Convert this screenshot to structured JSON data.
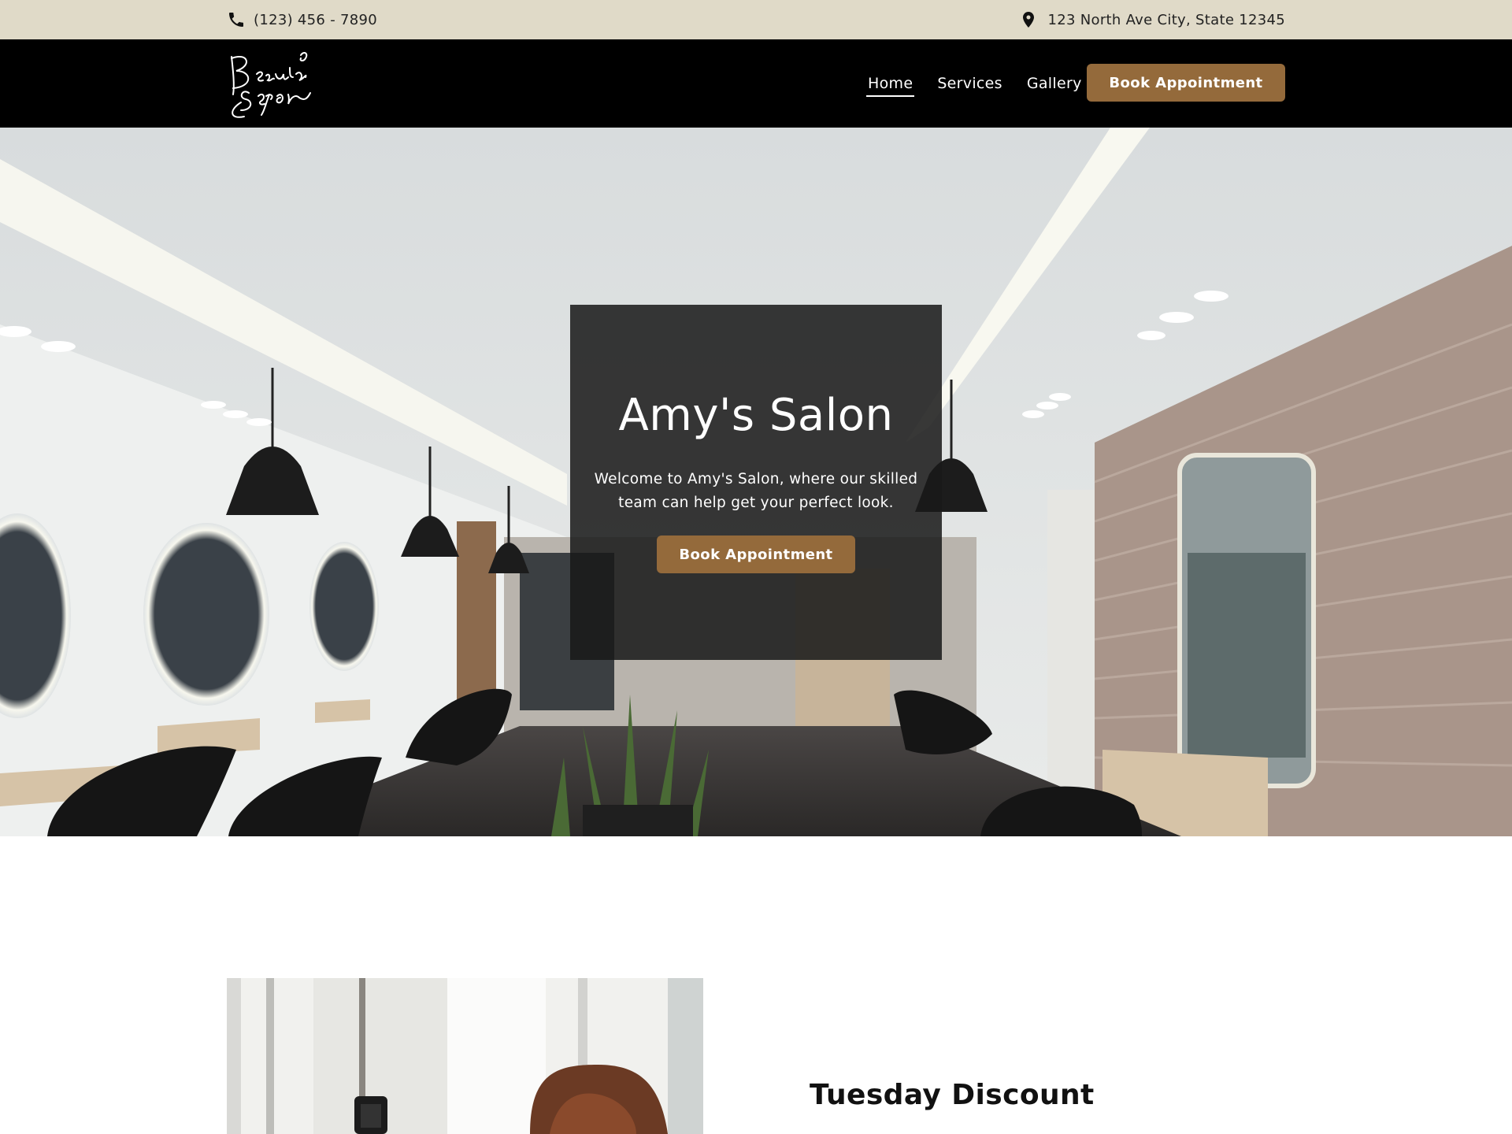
{
  "topbar": {
    "phone_icon": "phone-icon",
    "phone": "(123) 456 - 7890",
    "address_icon": "map-pin-icon",
    "address": "123 North Ave City, State 12345"
  },
  "nav": {
    "logo_alt": "Beauty Salon",
    "items": [
      {
        "label": "Home",
        "active": true
      },
      {
        "label": "Services",
        "active": false
      },
      {
        "label": "Gallery",
        "active": false
      }
    ],
    "cta_label": "Book Appointment"
  },
  "hero": {
    "title": "Amy's Salon",
    "text": "Welcome to Amy's Salon, where our skilled team can help get your perfect look.",
    "cta_label": "Book Appointment"
  },
  "promo": {
    "title": "Tuesday Discount"
  },
  "colors": {
    "topbar_bg": "#e0dac8",
    "nav_bg": "#000000",
    "accent": "#946a3b"
  }
}
